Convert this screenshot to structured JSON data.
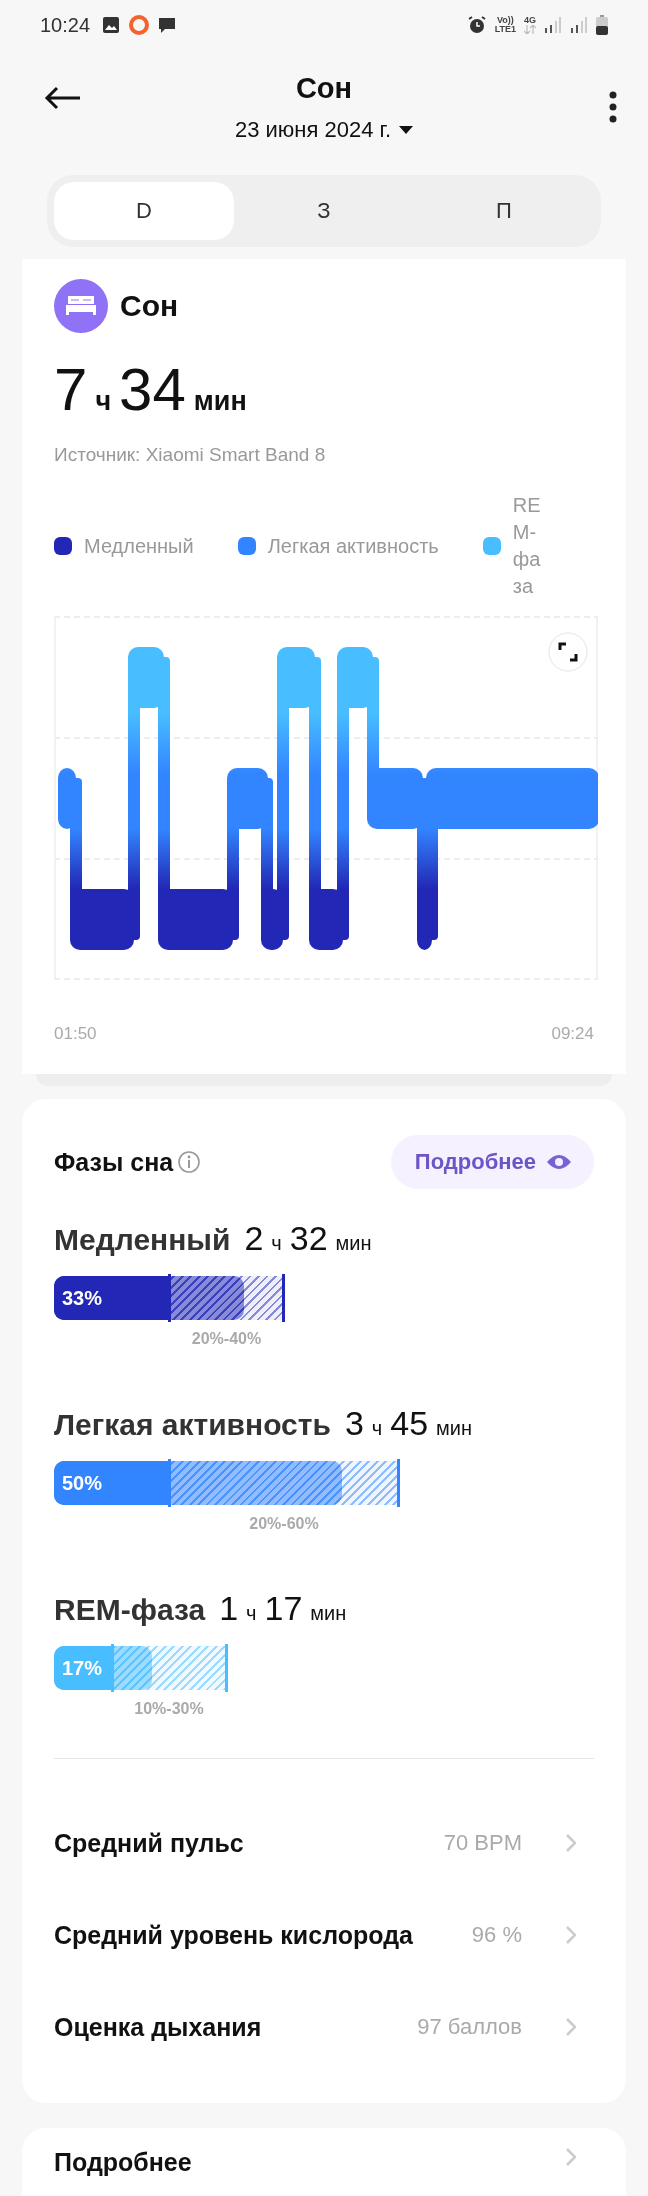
{
  "status_bar": {
    "time": "10:24",
    "volte": "Vo))",
    "lte": "LTE1",
    "network": "4G"
  },
  "header": {
    "title": "Сон",
    "date": "23 июня 2024 г."
  },
  "tabs": [
    {
      "label": "D",
      "selected": true
    },
    {
      "label": "З",
      "selected": false
    },
    {
      "label": "П",
      "selected": false
    }
  ],
  "summary": {
    "title": "Сон",
    "hours": "7",
    "hours_unit": "ч",
    "minutes": "34",
    "minutes_unit": "мин",
    "source": "Источник: Xiaomi Smart Band 8",
    "legend": [
      {
        "label": "Медленный",
        "color": "#2228b5"
      },
      {
        "label": "Легкая активность",
        "color": "#3385ff"
      },
      {
        "label": "REM-фаза",
        "color": "#48bdff"
      }
    ],
    "chart": {
      "start_time": "01:50",
      "end_time": "09:24"
    }
  },
  "phases": {
    "title": "Фазы сна",
    "details_button": "Подробнее",
    "items": [
      {
        "name": "Медленный",
        "hours": "2",
        "hours_unit": "ч",
        "minutes": "32",
        "minutes_unit": "мин",
        "percent": "33%",
        "range": "20%-40%",
        "color": "#2228b5"
      },
      {
        "name": "Легкая активность",
        "hours": "3",
        "hours_unit": "ч",
        "minutes": "45",
        "minutes_unit": "мин",
        "percent": "50%",
        "range": "20%-60%",
        "color": "#3385ff"
      },
      {
        "name": "REM-фаза",
        "hours": "1",
        "hours_unit": "ч",
        "minutes": "17",
        "minutes_unit": "мин",
        "percent": "17%",
        "range": "10%-30%",
        "color": "#48bdff"
      }
    ],
    "metrics": [
      {
        "label": "Средний пульс",
        "value": "70 BPM"
      },
      {
        "label": "Средний уровень кислорода",
        "value": "96 %"
      },
      {
        "label": "Оценка дыхания",
        "value": "97 баллов"
      }
    ]
  },
  "more": {
    "label": "Подробнее"
  }
}
